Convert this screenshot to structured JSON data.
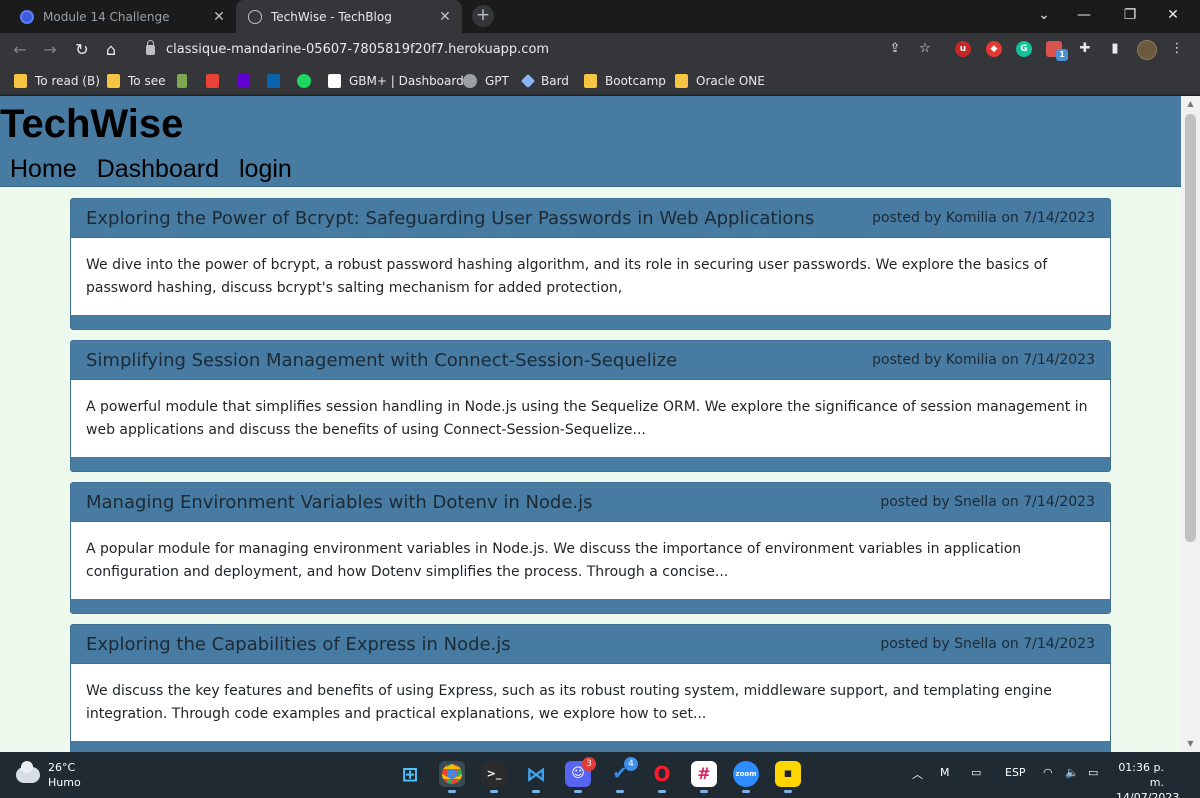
{
  "browser": {
    "tabs": [
      {
        "title": "Module 14 Challenge",
        "active": false
      },
      {
        "title": "TechWise - TechBlog",
        "active": true
      }
    ],
    "url": "classique-mandarine-05607-7805819f20f7.herokuapp.com",
    "bookmarks": [
      {
        "label": "To read (B)",
        "icon": "folder-icon"
      },
      {
        "label": "To see",
        "icon": "folder-icon"
      },
      {
        "label": "",
        "icon": "chess-icon"
      },
      {
        "label": "",
        "icon": "gmail-icon"
      },
      {
        "label": "",
        "icon": "yahoo-icon"
      },
      {
        "label": "",
        "icon": "outlook-icon"
      },
      {
        "label": "",
        "icon": "spotify-icon"
      },
      {
        "label": "GBM+ | Dashboard",
        "icon": "gbm-icon"
      },
      {
        "label": "GPT",
        "icon": "openai-icon"
      },
      {
        "label": "Bard",
        "icon": "bard-icon"
      },
      {
        "label": "Bootcamp",
        "icon": "folder-icon"
      },
      {
        "label": "Oracle ONE",
        "icon": "folder-icon"
      }
    ],
    "extension_badge": "1"
  },
  "site": {
    "title": "TechWise",
    "nav": [
      "Home",
      "Dashboard",
      "login"
    ],
    "colors": {
      "header": "#477ba2",
      "background": "#eef9ee"
    }
  },
  "posts": [
    {
      "title": "Exploring the Power of Bcrypt: Safeguarding User Passwords in Web Applications",
      "meta": "posted by Komilia on 7/14/2023",
      "body": "We dive into the power of bcrypt, a robust password hashing algorithm, and its role in securing user passwords. We explore the basics of password hashing, discuss bcrypt's salting mechanism for added protection,"
    },
    {
      "title": "Simplifying Session Management with Connect-Session-Sequelize",
      "meta": "posted by Komilia on 7/14/2023",
      "body": "A powerful module that simplifies session handling in Node.js using the Sequelize ORM. We explore the significance of session management in web applications and discuss the benefits of using Connect-Session-Sequelize..."
    },
    {
      "title": "Managing Environment Variables with Dotenv in Node.js",
      "meta": "posted by Snella on 7/14/2023",
      "body": "A popular module for managing environment variables in Node.js. We discuss the importance of environment variables in application configuration and deployment, and how Dotenv simplifies the process. Through a concise..."
    },
    {
      "title": "Exploring the Capabilities of Express in Node.js",
      "meta": "posted by Snella on 7/14/2023",
      "body": "We discuss the key features and benefits of using Express, such as its robust routing system, middleware support, and templating engine integration. Through code examples and practical explanations, we explore how to set..."
    }
  ],
  "taskbar": {
    "weather_temp": "26°C",
    "weather_desc": "Humo",
    "discord_badge": "3",
    "todo_badge": "4",
    "language": "ESP",
    "time": "01:36 p. m.",
    "date": "14/07/2023"
  }
}
